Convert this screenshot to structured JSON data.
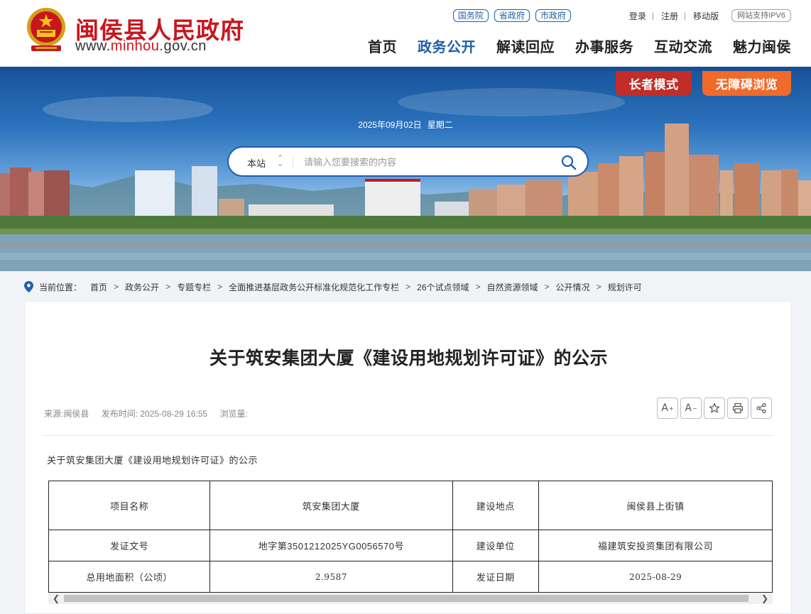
{
  "header": {
    "site_title": "闽侯县人民政府",
    "url_prefix": "www.",
    "url_highlight": "minhou",
    "url_suffix": ".gov.cn",
    "gov_links": [
      "国务院",
      "省政府",
      "市政府"
    ],
    "login": "登录",
    "register": "注册",
    "mobile": "移动版",
    "ipv6": "网站支持IPV6",
    "nav": [
      "首页",
      "政务公开",
      "解读回应",
      "办事服务",
      "互动交流",
      "魅力闽侯"
    ],
    "active_nav": "政务公开"
  },
  "banner": {
    "elder_mode": "长者模式",
    "accessible": "无障碍浏览",
    "date": "2025年09月02日",
    "weekday": "星期二",
    "search_scope": "本站",
    "search_placeholder": "请输入您要搜索的内容"
  },
  "breadcrumb": {
    "label": "当前位置：",
    "items": [
      "首页",
      "政务公开",
      "专题专栏",
      "全面推进基层政务公开标准化规范化工作专栏",
      "26个试点领域",
      "自然资源领域",
      "公开情况",
      "规划许可"
    ]
  },
  "article": {
    "title": "关于筑安集团大厦《建设用地规划许可证》的公示",
    "source": "来源:闽侯县",
    "published": "发布时间: 2025-08-29 16:55",
    "views": "浏览量:",
    "lead": "关于筑安集团大厦《建设用地规划许可证》的公示",
    "table": [
      [
        "项目名称",
        "筑安集团大厦",
        "建设地点",
        "闽侯县上街镇"
      ],
      [
        "发证文号",
        "地字第3501212025YG0056570号",
        "建设单位",
        "福建筑安投资集团有限公司"
      ],
      [
        "总用地面积（公顷）",
        "2.9587",
        "发证日期",
        "2025-08-29"
      ]
    ]
  },
  "tools": [
    "font-increase-icon",
    "font-decrease-icon",
    "star-icon",
    "print-icon",
    "share-icon"
  ],
  "colors": {
    "brand_red": "#c8161d",
    "brand_blue": "#1f5fa8",
    "elder_btn": "#c22d27",
    "access_btn": "#f06a2a"
  }
}
